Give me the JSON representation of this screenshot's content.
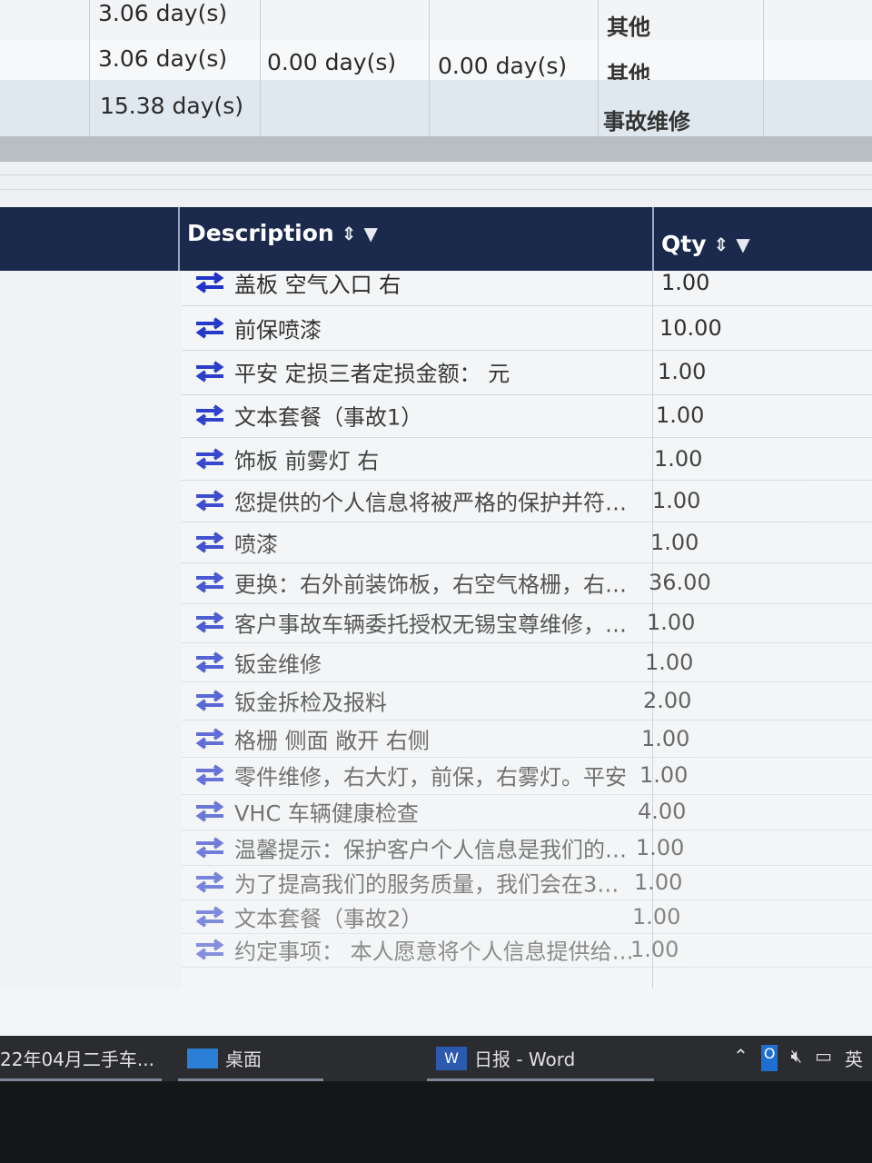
{
  "duration_table": {
    "rows": [
      {
        "c1": "3.06 day(s)",
        "c2": "",
        "c3": "",
        "type": "其他"
      },
      {
        "c1": "3.06 day(s)",
        "c2": "0.00 day(s)",
        "c3": "0.00 day(s)",
        "type": "其他"
      },
      {
        "c1": "15.38 day(s)",
        "c2": "",
        "c3": "",
        "type": "事故维修"
      }
    ]
  },
  "items_table": {
    "headers": {
      "description": "Description",
      "qty": "Qty"
    },
    "rows": [
      {
        "description": "盖板 空气入口 右",
        "qty": "1.00"
      },
      {
        "description": "前保喷漆",
        "qty": "10.00"
      },
      {
        "description": "平安 定损三者定损金额： 元",
        "qty": "1.00"
      },
      {
        "description": "文本套餐（事故1）",
        "qty": "1.00"
      },
      {
        "description": "饰板 前雾灯 右",
        "qty": "1.00"
      },
      {
        "description": "您提供的个人信息将被严格的保护并符…",
        "qty": "1.00"
      },
      {
        "description": "喷漆",
        "qty": "1.00"
      },
      {
        "description": "更换：右外前装饰板，右空气格栅，右…",
        "qty": "36.00"
      },
      {
        "description": "客户事故车辆委托授权无锡宝尊维修，…",
        "qty": "1.00"
      },
      {
        "description": "钣金维修",
        "qty": "1.00"
      },
      {
        "description": "钣金拆检及报料",
        "qty": "2.00"
      },
      {
        "description": "格栅 侧面 敞开 右侧",
        "qty": "1.00"
      },
      {
        "description": "零件维修，右大灯，前保，右雾灯。平安",
        "qty": "1.00"
      },
      {
        "description": "VHC 车辆健康检查",
        "qty": "4.00"
      },
      {
        "description": "温馨提示：保护客户个人信息是我们的…",
        "qty": "1.00"
      },
      {
        "description": "为了提高我们的服务质量，我们会在3天…",
        "qty": "1.00"
      },
      {
        "description": "文本套餐（事故2）",
        "qty": "1.00"
      },
      {
        "description": "约定事项： 本人愿意将个人信息提供给…",
        "qty": "1.00"
      }
    ]
  },
  "taskbar": {
    "item1": "22年04月二手车...",
    "item2": "桌面",
    "item3": "日报 - Word",
    "ime": "英"
  },
  "colors": {
    "header_bg": "#1b2a4c",
    "swap_icon": "#1f33c8",
    "taskbar_bg": "#2b2c30"
  }
}
